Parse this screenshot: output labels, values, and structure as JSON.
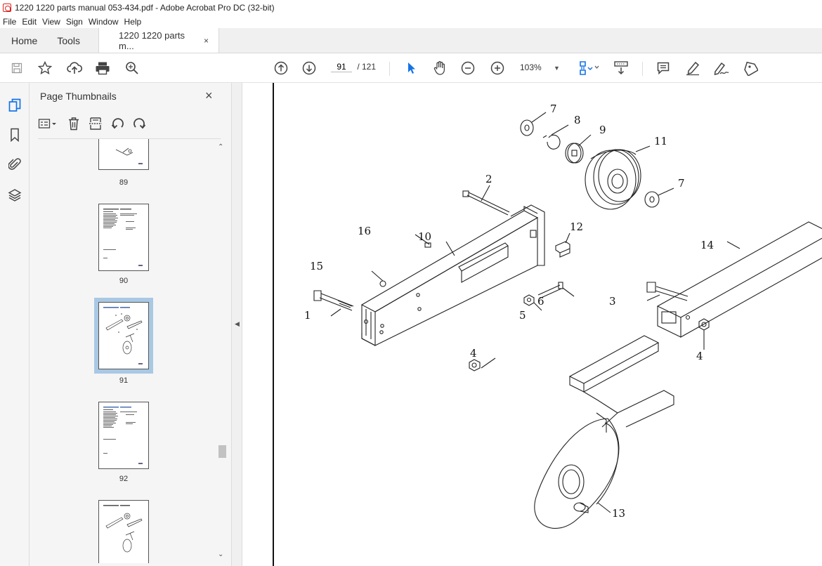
{
  "window": {
    "title": "1220 1220 parts manual 053-434.pdf - Adobe Acrobat Pro DC (32-bit)"
  },
  "menu": [
    "File",
    "Edit",
    "View",
    "Sign",
    "Window",
    "Help"
  ],
  "tabs": {
    "home": "Home",
    "tools": "Tools",
    "document": "1220 1220 parts m...",
    "close": "×"
  },
  "toolbar": {
    "page_current": "91",
    "page_total": "/ 121",
    "zoom": "103%"
  },
  "panel": {
    "title": "Page Thumbnails",
    "close": "×",
    "thumbnails": [
      {
        "label": "89"
      },
      {
        "label": "90"
      },
      {
        "label": "91",
        "selected": true
      },
      {
        "label": "92"
      },
      {
        "label": ""
      }
    ]
  },
  "drawing": {
    "callouts": [
      "7",
      "8",
      "9",
      "11",
      "7",
      "2",
      "12",
      "16",
      "10",
      "14",
      "15",
      "3",
      "6",
      "1",
      "5",
      "4",
      "4",
      "13"
    ]
  }
}
